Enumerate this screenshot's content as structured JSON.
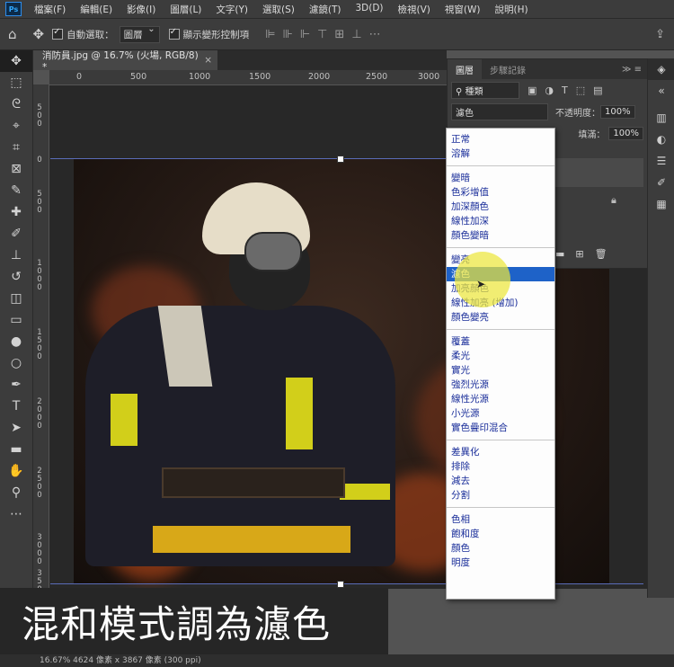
{
  "menubar": {
    "logo": "Ps",
    "items": [
      "檔案(F)",
      "編輯(E)",
      "影像(I)",
      "圖層(L)",
      "文字(Y)",
      "選取(S)",
      "濾鏡(T)",
      "3D(D)",
      "檢視(V)",
      "視窗(W)",
      "說明(H)"
    ]
  },
  "options": {
    "home_icon": "home-icon",
    "move_icon": "move-icon",
    "auto_select_label": "自動選取：",
    "auto_select_value": "圖層",
    "transform_label": "顯示變形控制項"
  },
  "document": {
    "tab_title": "消防員.jpg @ 16.7% (火場, RGB/8) *",
    "close": "×"
  },
  "ruler": {
    "h_ticks": [
      "0",
      "500",
      "1000",
      "1500",
      "2000",
      "2500",
      "3000"
    ],
    "v_ticks": [
      "5\n0\n0",
      "0",
      "5\n0\n0",
      "1\n0\n0\n0",
      "1\n5\n0\n0",
      "2\n0\n0\n0",
      "2\n5\n0\n0",
      "3\n0\n0\n0",
      "3\n5\n0\n0"
    ]
  },
  "layers_panel": {
    "tabs": [
      "圖層",
      "步驟記錄"
    ],
    "filter_label": "種類",
    "blend_value": "濾色",
    "opacity_label": "不透明度：",
    "opacity_value": "100%",
    "fill_label": "填滿：",
    "fill_value": "100%"
  },
  "blend_menu": {
    "groups": [
      [
        "正常",
        "溶解"
      ],
      [
        "變暗",
        "色彩增值",
        "加深顏色",
        "線性加深",
        "顏色變暗"
      ],
      [
        "變亮",
        "濾色",
        "加亮顏色",
        "線性加亮 (增加)",
        "顏色變亮"
      ],
      [
        "覆蓋",
        "柔光",
        "實光",
        "強烈光源",
        "線性光源",
        "小光源",
        "實色疊印混合"
      ],
      [
        "差異化",
        "排除",
        "減去",
        "分割"
      ],
      [
        "色相",
        "飽和度",
        "顏色",
        "明度"
      ]
    ],
    "selected": "濾色"
  },
  "caption": "混和模式調為濾色",
  "status": "16.67%    4624 像素 x 3867 像素 (300 ppi)",
  "colors": {
    "accent": "#1e62c8",
    "highlight": "#ebe63c",
    "stripe": "#d2cf1a"
  }
}
